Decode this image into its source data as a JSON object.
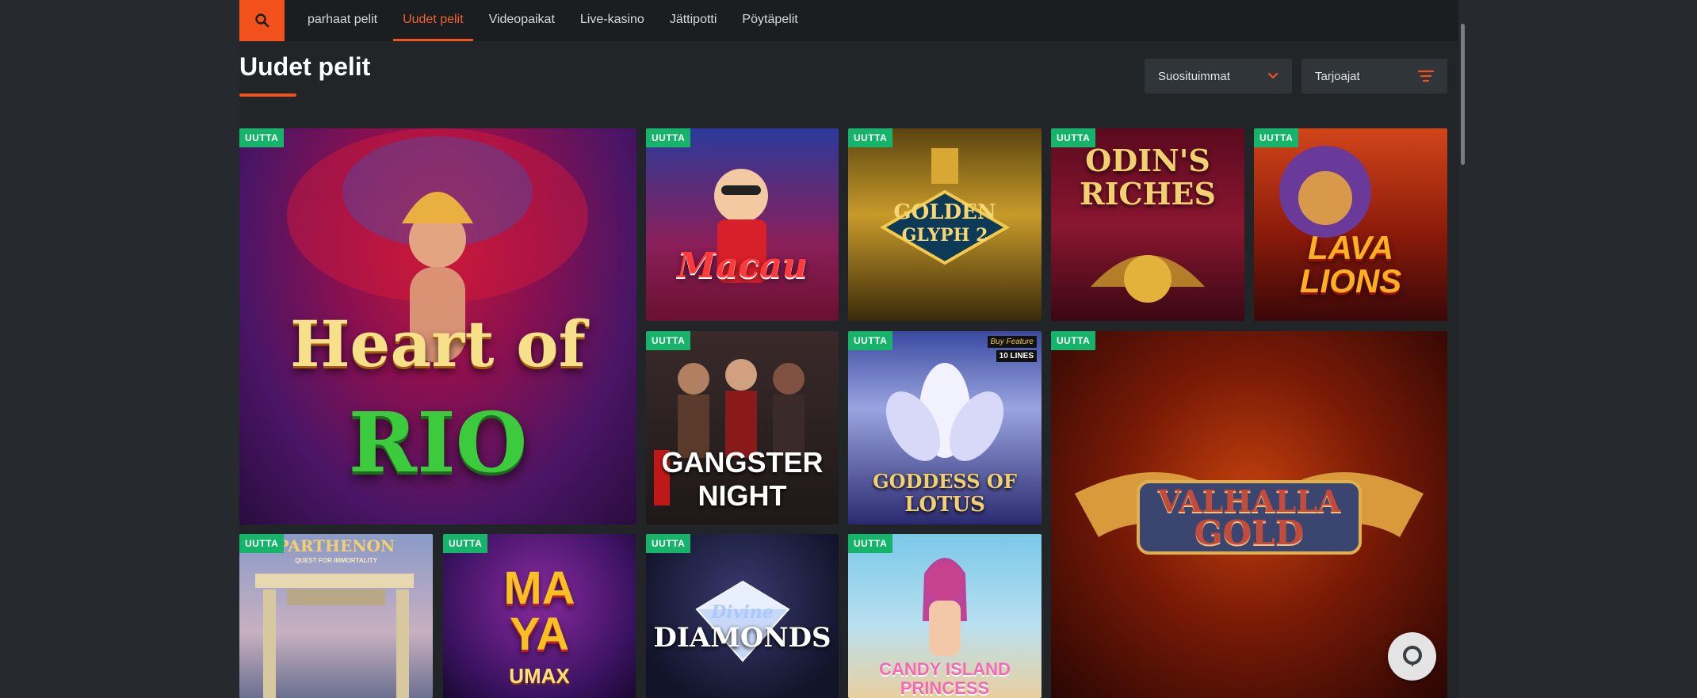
{
  "nav": {
    "items": [
      {
        "label": "parhaat pelit"
      },
      {
        "label": "Uudet pelit"
      },
      {
        "label": "Videopaikat"
      },
      {
        "label": "Live-kasino"
      },
      {
        "label": "Jättipotti"
      },
      {
        "label": "Pöytäpelit"
      }
    ],
    "active_index": 1
  },
  "page": {
    "title": "Uudet pelit",
    "sort_dropdown": "Suosituimmat",
    "provider_filter": "Tarjoajat"
  },
  "badge_label": "UUTTA",
  "games": [
    {
      "title_line1": "Heart of",
      "title_line2": "RIO"
    },
    {
      "title_line1": "Macau",
      "title_line2": ""
    },
    {
      "title_line1": "GOLDEN",
      "title_line2": "GLYPH 2"
    },
    {
      "title_line1": "ODIN'S",
      "title_line2": "RICHES"
    },
    {
      "title_line1": "LAVA",
      "title_line2": "LIONS"
    },
    {
      "title_line1": "GANGSTER",
      "title_line2": "NIGHT"
    },
    {
      "title_line1": "GODDESS OF",
      "title_line2": "LOTUS"
    },
    {
      "title_line1": "VALHALLA",
      "title_line2": "GOLD"
    },
    {
      "title_line1": "PARTHENON",
      "title_line2": "QUEST FOR IMMORTALITY"
    },
    {
      "title_line1": "MA",
      "title_line2": "YA"
    },
    {
      "title_line1": "Divine",
      "title_line2": "DIAMONDS"
    },
    {
      "title_line1": "CANDY ISLAND",
      "title_line2": "PRINCESS"
    }
  ],
  "extra_labels": {
    "lotus_buy": "Buy Feature",
    "lotus_lines": "10 LINES",
    "maya_max": "UMAX"
  },
  "colors": {
    "accent": "#f2511b",
    "badge": "#16b36b",
    "background": "#212528"
  }
}
